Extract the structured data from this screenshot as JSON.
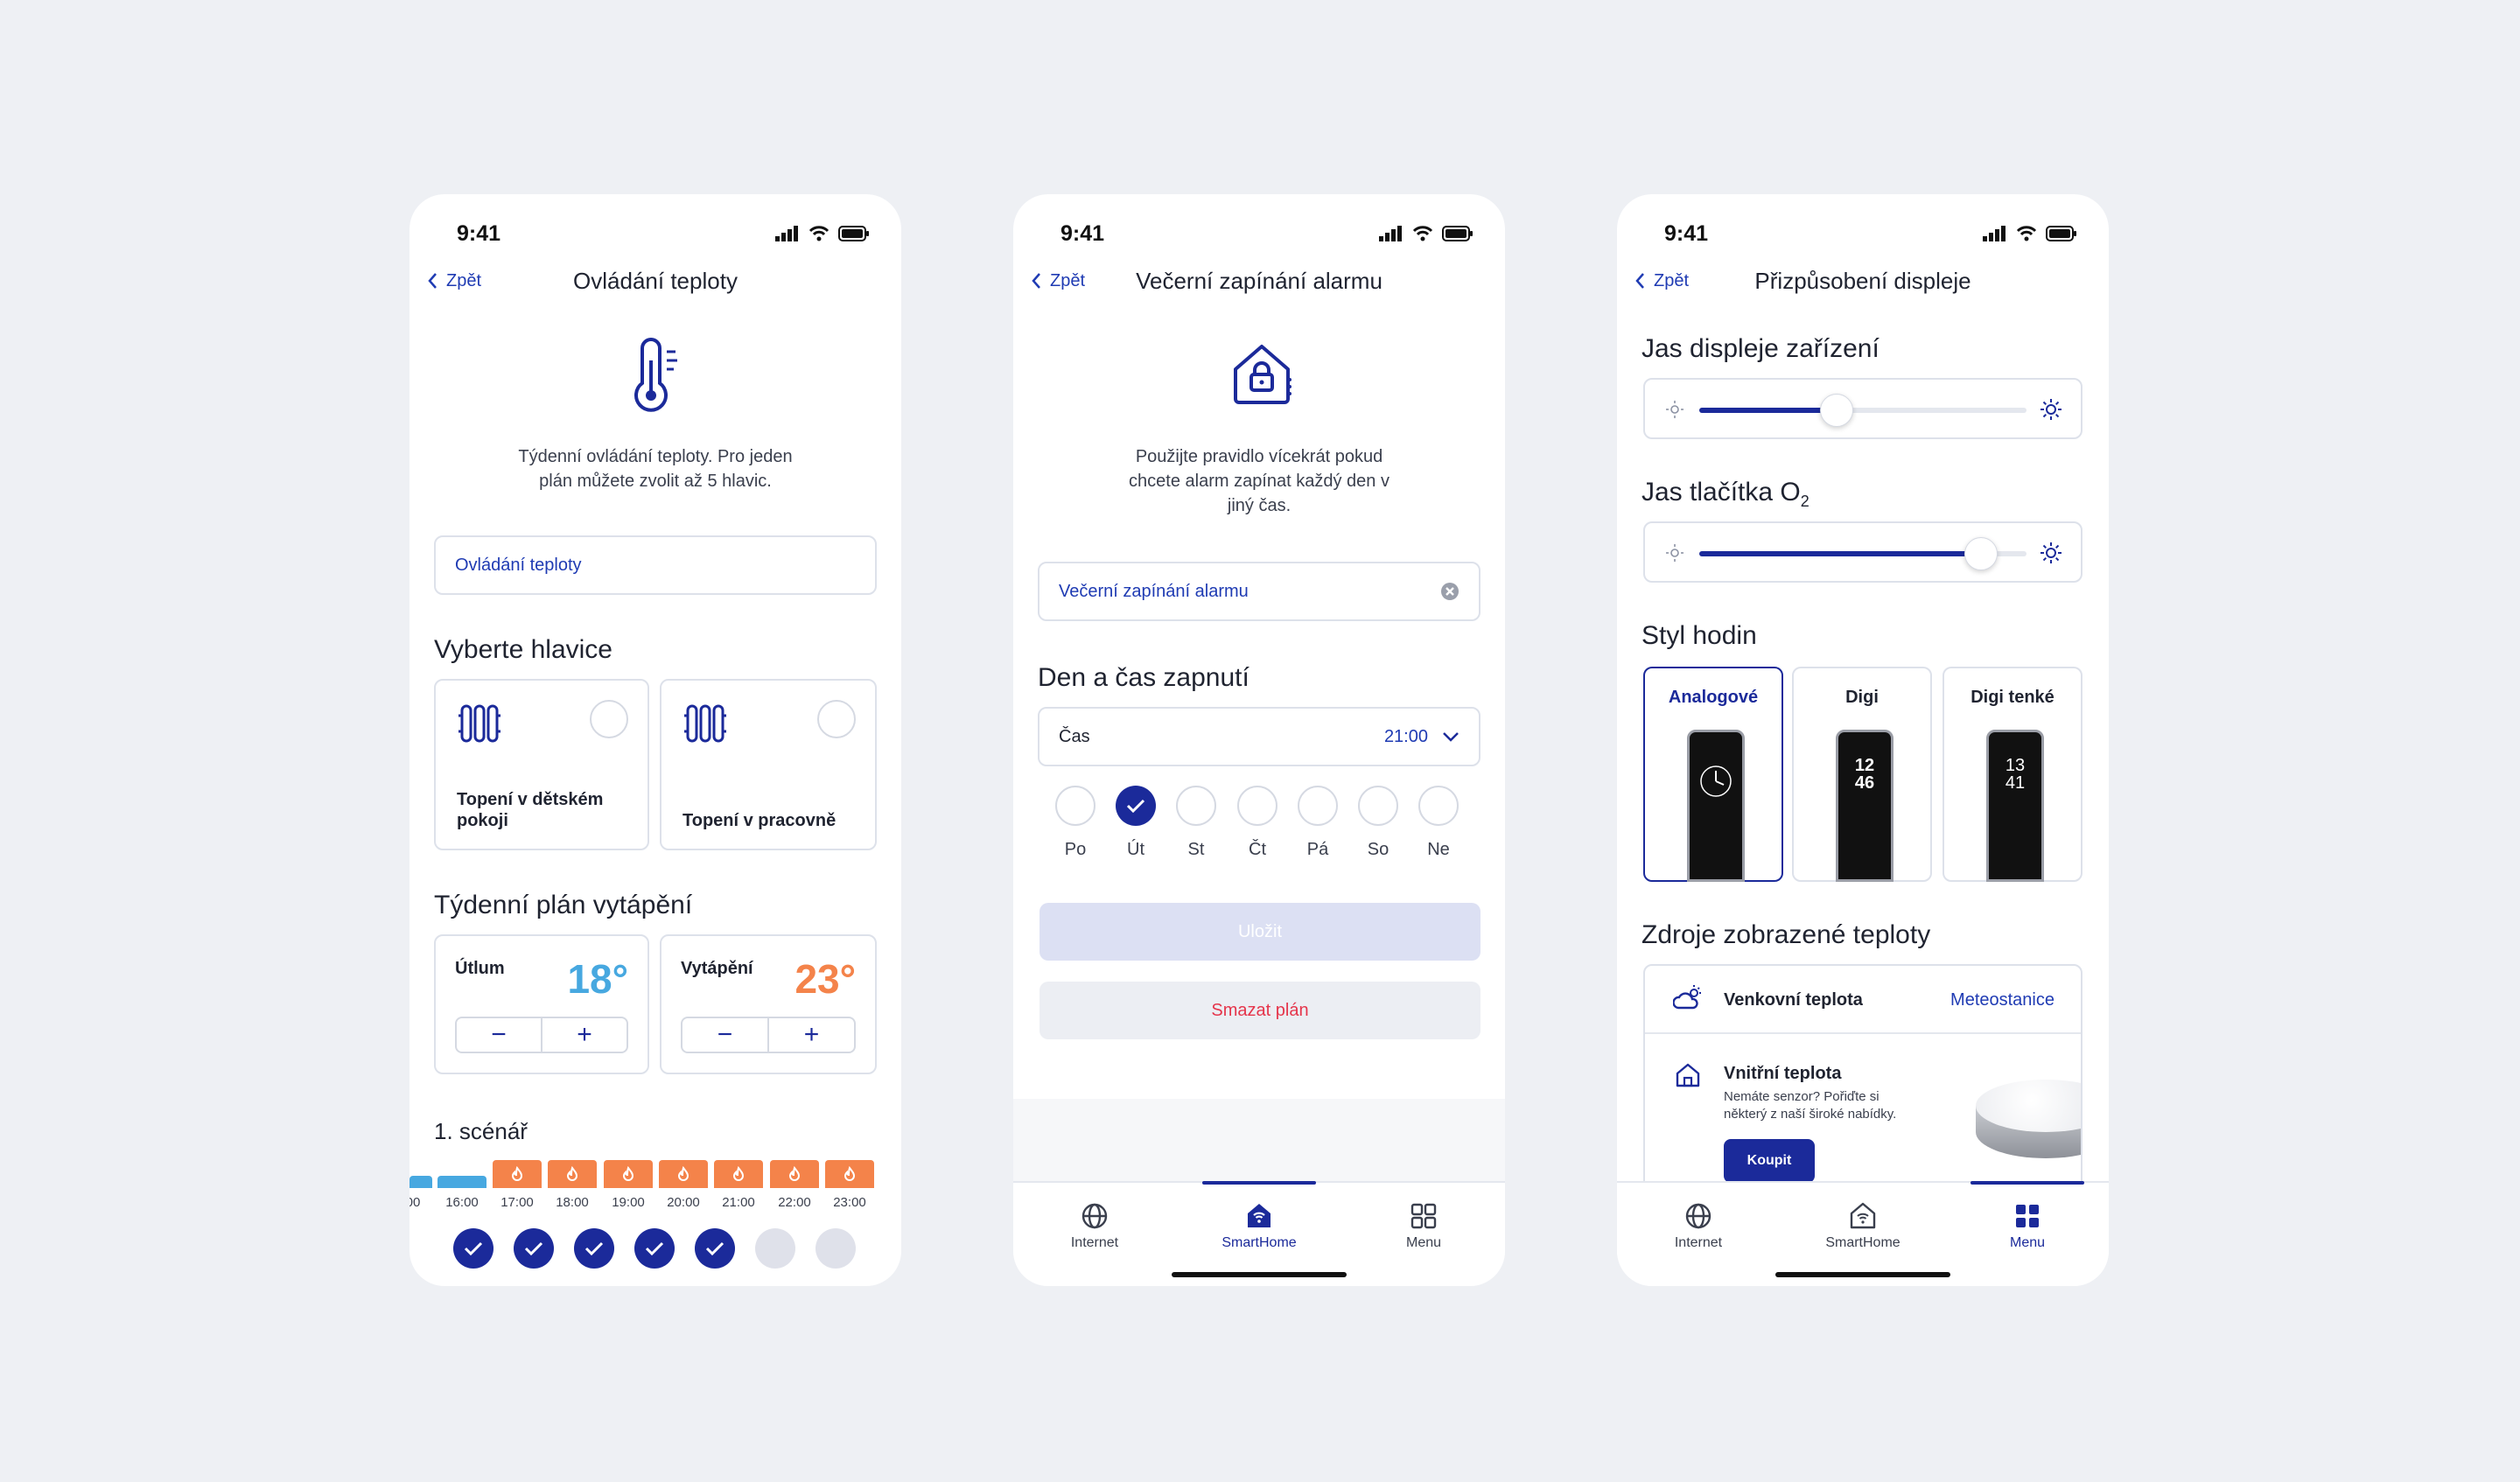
{
  "status": {
    "time": "9:41"
  },
  "common": {
    "back": "Zpět"
  },
  "screen1": {
    "title": "Ovládání teploty",
    "intro_l1": "Týdenní ovládání teploty. Pro jeden",
    "intro_l2": "plán můžete zvolit až 5 hlavic.",
    "name_value": "Ovládání teploty",
    "heads_title": "Vyberte hlavice",
    "heads": [
      {
        "l1": "Topení v dětském",
        "l2": "pokoji"
      },
      {
        "l1": "Topení v pracovně",
        "l2": ""
      }
    ],
    "plan_title": "Týdenní plán vytápění",
    "modes": [
      {
        "label": "Útlum",
        "temp": "18°",
        "color": "#47a8e0"
      },
      {
        "label": "Vytápění",
        "temp": "23°",
        "color": "#f4834a"
      }
    ],
    "minus": "−",
    "plus": "+",
    "scenario": "1. scénář",
    "ticks": [
      "00",
      "16:00",
      "17:00",
      "18:00",
      "19:00",
      "20:00",
      "21:00",
      "22:00",
      "23:00"
    ],
    "days_checked": [
      true,
      true,
      true,
      true,
      true,
      false,
      false
    ]
  },
  "screen2": {
    "title": "Večerní zapínání alarmu",
    "intro_l1": "Použijte pravidlo vícekrát pokud",
    "intro_l2": "chcete alarm zapínat každý den v",
    "intro_l3": "jiný čas.",
    "name_value": "Večerní zapínání alarmu",
    "section": "Den a čas zapnutí",
    "time_label": "Čas",
    "time_value": "21:00",
    "days": [
      "Po",
      "Út",
      "St",
      "Čt",
      "Pá",
      "So",
      "Ne"
    ],
    "days_checked": [
      false,
      true,
      false,
      false,
      false,
      false,
      false
    ],
    "save": "Uložit",
    "delete": "Smazat plán"
  },
  "screen3": {
    "title": "Přizpůsobení displeje",
    "bright_title": "Jas displeje zařízení",
    "bright_value": 0.42,
    "button_title_a": "Jas tlačítka O",
    "button_title_sub": "2",
    "button_value": 0.86,
    "clock_title": "Styl hodin",
    "styles": [
      "Analogové",
      "Digi",
      "Digi tenké"
    ],
    "digi_hour": "12",
    "digi_min": "46",
    "thin_hour": "13",
    "thin_min": "41",
    "sources_title": "Zdroje zobrazené teploty",
    "outdoor": "Venkovní teplota",
    "outdoor_value": "Meteostanice",
    "indoor": "Vnitřní teplota",
    "indoor_desc_l1": "Nemáte senzor? Pořiďte si",
    "indoor_desc_l2": "některý z naší široké nabídky.",
    "buy": "Koupit"
  },
  "tabs": {
    "internet": "Internet",
    "smarthome": "SmartHome",
    "menu": "Menu"
  },
  "colors": {
    "primary": "#1b2a9a",
    "link": "#1f3bb3",
    "cold": "#47a8e0",
    "warm": "#f4834a",
    "danger": "#e5354b"
  }
}
